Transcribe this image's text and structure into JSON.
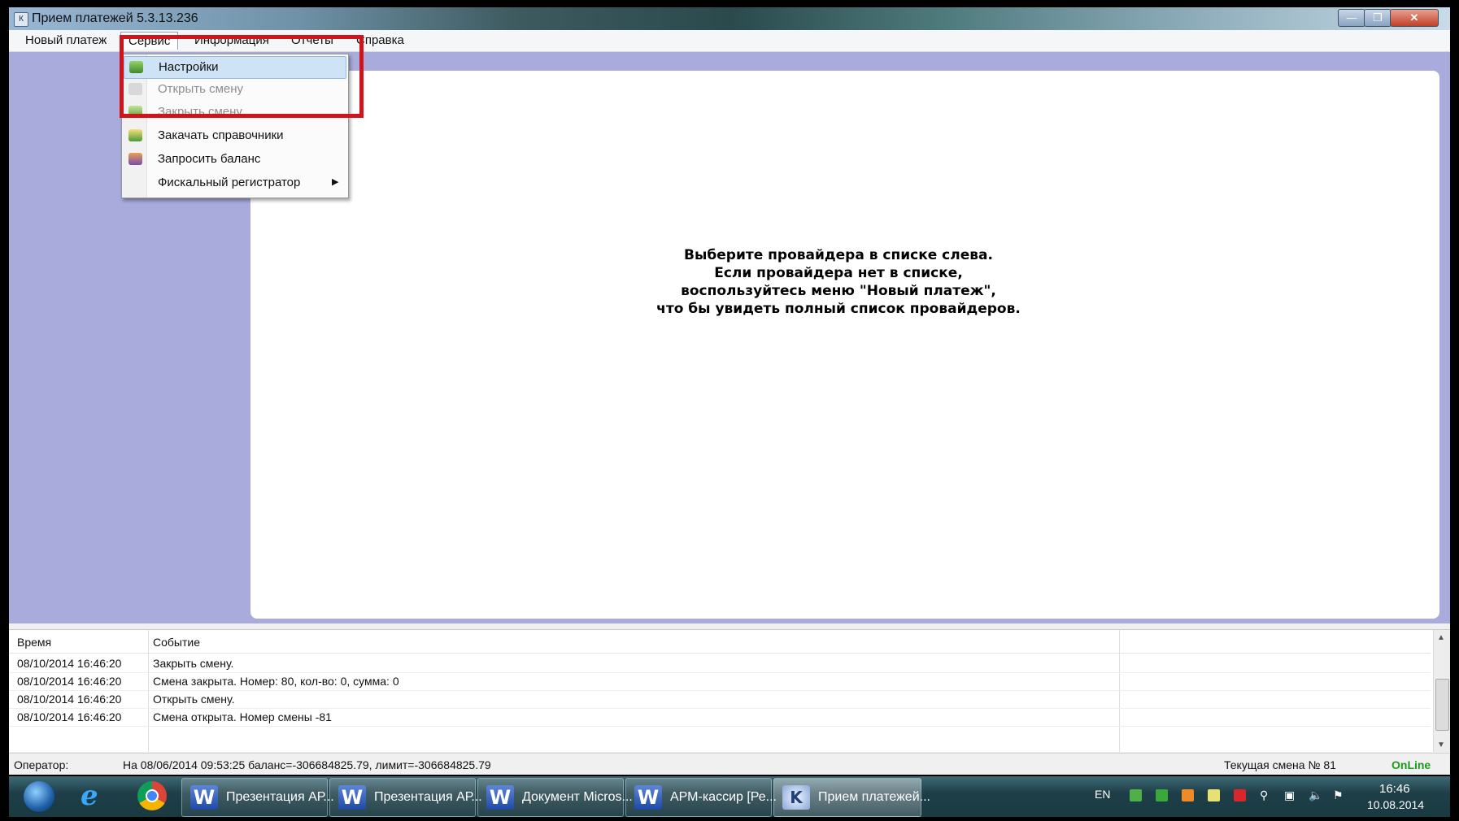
{
  "window": {
    "title": "Прием платежей 5.3.13.236"
  },
  "menubar": {
    "new_payment": "Новый платеж",
    "service": "Сервис",
    "info": "Информация",
    "reports": "Отчеты",
    "help": "Справка"
  },
  "service_menu": {
    "items": [
      {
        "label": "Настройки",
        "icon": "settings-icon",
        "enabled": true
      },
      {
        "label": "Открыть смену",
        "icon": "open-shift-icon",
        "enabled": false
      },
      {
        "label": "Закрыть смену",
        "icon": "close-shift-icon",
        "enabled": false
      },
      {
        "label": "Закачать справочники",
        "icon": "download-directories-icon",
        "enabled": true
      },
      {
        "label": "Запросить баланс",
        "icon": "request-balance-icon",
        "enabled": true
      },
      {
        "label": "Фискальный регистратор",
        "icon": "",
        "enabled": true,
        "submenu": true
      }
    ]
  },
  "main": {
    "message_lines": [
      "Выберите провайдера в списке слева.",
      "Если провайдера нет в списке,",
      "воспользуйтесь меню \"Новый платеж\",",
      "что бы увидеть полный список провайдеров."
    ]
  },
  "log": {
    "columns": [
      "Время",
      "Событие"
    ],
    "rows": [
      {
        "time": "08/10/2014 16:46:20",
        "event": "Закрыть смену."
      },
      {
        "time": "08/10/2014 16:46:20",
        "event": "Смена закрыта. Номер: 80, кол-во: 0, сумма: 0"
      },
      {
        "time": "08/10/2014 16:46:20",
        "event": "Открыть смену."
      },
      {
        "time": "08/10/2014 16:46:20",
        "event": "Смена открыта. Номер смены -81"
      }
    ]
  },
  "status": {
    "operator_label": "Оператор:",
    "balance_text": "На 08/06/2014 09:53:25 баланс=-306684825.79, лимит=-306684825.79",
    "shift_text": "Текущая смена № 81",
    "online_text": "OnLine"
  },
  "taskbar": {
    "tasks": [
      {
        "label": "Презентация АР...",
        "icon": "word-icon"
      },
      {
        "label": "Презентация АР...",
        "icon": "word-icon"
      },
      {
        "label": "Документ Micros...",
        "icon": "word-icon"
      },
      {
        "label": "АРМ-кассир [Ре...",
        "icon": "word-icon"
      },
      {
        "label": "Прием платежей...",
        "icon": "payment-app-icon"
      }
    ],
    "language": "EN",
    "time": "16:46",
    "date": "10.08.2014"
  },
  "colors": {
    "highlight_box": "#d0141c",
    "online": "#1b9a1b",
    "panel": "#a8abdb"
  }
}
